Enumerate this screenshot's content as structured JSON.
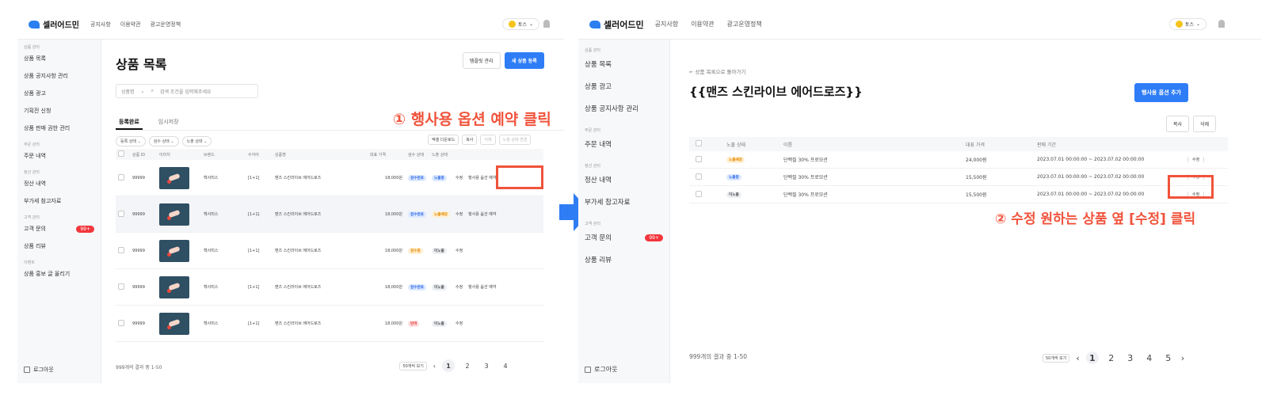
{
  "brand": "셀러어드민",
  "nav": [
    "공지사항",
    "이용약관",
    "광고운영정책"
  ],
  "user": "토스",
  "left": {
    "sidebar": [
      {
        "type": "group",
        "label": "상품 관리"
      },
      {
        "type": "item",
        "label": "상품 목록"
      },
      {
        "type": "item",
        "label": "상품 공지사항 관리"
      },
      {
        "type": "item",
        "label": "상품 광고"
      },
      {
        "type": "item",
        "label": "기획전 신청"
      },
      {
        "type": "item",
        "label": "상품 판매 권한 관리"
      },
      {
        "type": "group",
        "label": "주문 관리"
      },
      {
        "type": "item",
        "label": "주문 내역"
      },
      {
        "type": "group",
        "label": "정산 관리"
      },
      {
        "type": "item",
        "label": "정산 내역"
      },
      {
        "type": "item",
        "label": "부가세 참고자료"
      },
      {
        "type": "group",
        "label": "고객 관리"
      },
      {
        "type": "item",
        "label": "고객 문의",
        "badge": "99+"
      },
      {
        "type": "item",
        "label": "상품 리뷰"
      },
      {
        "type": "group",
        "label": "이벤트"
      },
      {
        "type": "item",
        "label": "상품 홍보 글 올리기"
      }
    ],
    "logout": "로그아웃",
    "title": "상품 목록",
    "btn_template": "템플릿 관리",
    "btn_new": "새 상품 등록",
    "search_label": "상품명",
    "search_placeholder": "검색 조건을 입력해주세요",
    "tabs": [
      "등록완료",
      "임시저장"
    ],
    "filters": [
      "등록 상태",
      "검수 상태",
      "노출 상태"
    ],
    "actions": [
      "엑셀 다운로드",
      "복사",
      "삭제",
      "노출 상태 변경"
    ],
    "columns": [
      "",
      "상품 ID",
      "이미지",
      "브랜드",
      "수식어",
      "상품명",
      "대표 가격",
      "검수 상태",
      "노출 상태",
      "",
      ""
    ],
    "rows": [
      {
        "id": "99999",
        "brand": "헥사미스",
        "mod": "[1+1]",
        "name": "맨즈 스킨라이브 에어드로즈",
        "price": "18,000원",
        "review": "검수완료",
        "review_color": "blue",
        "expose": "노출중",
        "expose_color": "blue",
        "edit": "수정",
        "option": "행사용 옵션 예약"
      },
      {
        "id": "99999",
        "brand": "헥사미스",
        "mod": "[1+1]",
        "name": "맨즈 스킨라이브 에어드로즈",
        "price": "18,000원",
        "review": "검수완료",
        "review_color": "blue",
        "expose": "노출예정",
        "expose_color": "orange",
        "edit": "수정",
        "option": "행사용 옵션 예약"
      },
      {
        "id": "99999",
        "brand": "헥사미스",
        "mod": "[1+1]",
        "name": "맨즈 스킨라이브 에어드로즈",
        "price": "18,000원",
        "review": "검수중",
        "review_color": "orange",
        "expose": "미노출",
        "expose_color": "gray",
        "edit": "수정",
        "option": ""
      },
      {
        "id": "99999",
        "brand": "헥사미스",
        "mod": "[1+1]",
        "name": "맨즈 스킨라이브 에어드로즈",
        "price": "18,000원",
        "review": "검수완료",
        "review_color": "blue",
        "expose": "미노출",
        "expose_color": "gray",
        "edit": "수정",
        "option": "행사용 옵션 예약"
      },
      {
        "id": "99999",
        "brand": "헥사미스",
        "mod": "[1+1]",
        "name": "맨즈 스킨라이브 에어드로즈",
        "price": "18,000원",
        "review": "반려",
        "review_color": "red",
        "expose": "미노출",
        "expose_color": "gray",
        "edit": "수정",
        "option": ""
      }
    ],
    "footer": "999개의 결과 중 1-50",
    "per_page": "50개씩 보기",
    "pages": [
      "1",
      "2",
      "3",
      "4"
    ]
  },
  "right": {
    "sidebar": [
      {
        "type": "group",
        "label": "상품 관리"
      },
      {
        "type": "item",
        "label": "상품 목록"
      },
      {
        "type": "item",
        "label": "상품 광고"
      },
      {
        "type": "item",
        "label": "상품 공지사항 관리"
      },
      {
        "type": "group",
        "label": "주문 관리"
      },
      {
        "type": "item",
        "label": "주문 내역"
      },
      {
        "type": "group",
        "label": "정산 관리"
      },
      {
        "type": "item",
        "label": "정산 내역"
      },
      {
        "type": "item",
        "label": "부가세 참고자료"
      },
      {
        "type": "group",
        "label": "고객 관리"
      },
      {
        "type": "item",
        "label": "고객 문의",
        "badge": "99+"
      },
      {
        "type": "item",
        "label": "상품 리뷰"
      }
    ],
    "logout": "로그아웃",
    "back": "← 상품 목록으로 돌아가기",
    "title": "{{맨즈 스킨라이브 에어드로즈}}",
    "btn_add": "행사용 옵션 추가",
    "btn_copy": "복사",
    "btn_delete": "삭제",
    "columns": [
      "",
      "노출 상태",
      "이름",
      "대표 가격",
      "판매 기간",
      ""
    ],
    "rows": [
      {
        "status": "노출예정",
        "status_color": "orange",
        "name": "단백질 30% 프로모션",
        "price": "24,000원",
        "period": "2023.07.01 00:00:00 ~ 2023.07.02 00:00:00",
        "edit": "수정"
      },
      {
        "status": "노출중",
        "status_color": "blue",
        "name": "단백질 30% 프로모션",
        "price": "15,500원",
        "period": "2023.07.01 00:00:00 ~ 2023.07.02 00:00:00",
        "edit": "수정"
      },
      {
        "status": "미노출",
        "status_color": "gray",
        "name": "단백질 30% 프로모션",
        "price": "15,500원",
        "period": "2023.07.01 00:00:00 ~ 2023.07.02 00:00:00",
        "edit": "수정"
      }
    ],
    "footer": "999개의 결과 중 1-50",
    "per_page": "50개씩 보기",
    "pages": [
      "1",
      "2",
      "3",
      "4",
      "5"
    ]
  },
  "callouts": {
    "step1": "① 행사용  옵션 예약 클릭",
    "step2": "② 수정 원하는 상품 옆 [수정] 클릭"
  },
  "colors": {
    "accent": "#2e7df6",
    "callout": "#f0533b",
    "arrow": "#2f7df4"
  }
}
